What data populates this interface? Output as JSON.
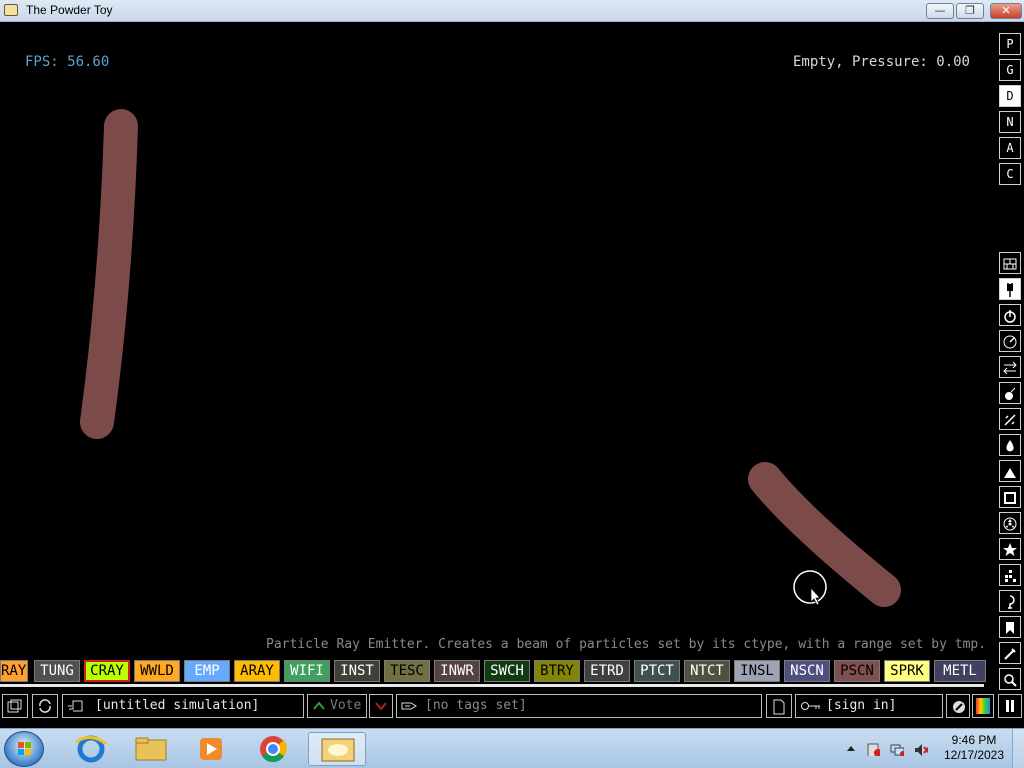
{
  "window": {
    "title": "The Powder Toy",
    "minimize": "—",
    "maximize": "❐",
    "close": "✕"
  },
  "hud": {
    "fps": "FPS: 56.60",
    "status": "Empty, Pressure: 0.00"
  },
  "element_description": "Particle Ray Emitter. Creates a beam of particles set by its ctype, with a range set by tmp.",
  "side_buttons_top": [
    "P",
    "G",
    "D",
    "N",
    "A",
    "C"
  ],
  "side_buttons_active": "D",
  "side_menu_icons": [
    "walls-icon",
    "electronics-icon",
    "powered-icon",
    "sensors-icon",
    "force-icon",
    "explosives-icon",
    "gases-icon",
    "liquids-icon",
    "powders-icon",
    "solids-icon",
    "radioactive-icon",
    "special-icon",
    "life-icon",
    "tools-icon",
    "favorites-icon",
    "decoration-icon",
    "search-icon"
  ],
  "elements": [
    {
      "label": "RAY",
      "bg": "#ffa030",
      "fg": "#000000"
    },
    {
      "label": "TUNG",
      "bg": "#505050",
      "fg": "#ffffff"
    },
    {
      "label": "CRAY",
      "bg": "#bbff00",
      "fg": "#000000",
      "selected": true
    },
    {
      "label": "WWLD",
      "bg": "#ffa820",
      "fg": "#000000"
    },
    {
      "label": "EMP",
      "bg": "#66aaff",
      "fg": "#ffffff"
    },
    {
      "label": "ARAY",
      "bg": "#ffbb00",
      "fg": "#000000"
    },
    {
      "label": "WIFI",
      "bg": "#40a060",
      "fg": "#ffffff"
    },
    {
      "label": "INST",
      "bg": "#404039",
      "fg": "#ffffff"
    },
    {
      "label": "TESC",
      "bg": "#707040",
      "fg": "#000000"
    },
    {
      "label": "INWR",
      "bg": "#544141",
      "fg": "#ffffff"
    },
    {
      "label": "SWCH",
      "bg": "#103b11",
      "fg": "#ffffff"
    },
    {
      "label": "BTRY",
      "bg": "#858505",
      "fg": "#000000"
    },
    {
      "label": "ETRD",
      "bg": "#404040",
      "fg": "#ffffff"
    },
    {
      "label": "PTCT",
      "bg": "#405050",
      "fg": "#ffffff"
    },
    {
      "label": "NTCT",
      "bg": "#505040",
      "fg": "#ffffff"
    },
    {
      "label": "INSL",
      "bg": "#9ea3b6",
      "fg": "#000000"
    },
    {
      "label": "NSCN",
      "bg": "#505080",
      "fg": "#ffffff"
    },
    {
      "label": "PSCN",
      "bg": "#805050",
      "fg": "#000000"
    },
    {
      "label": "SPRK",
      "bg": "#ffff80",
      "fg": "#000000"
    },
    {
      "label": "METL",
      "bg": "#404060",
      "fg": "#ffffff"
    }
  ],
  "bottom_bar": {
    "save_name": "[untitled simulation]",
    "vote": "Vote",
    "tags": "[no tags set]",
    "sign_in": "[sign in]"
  },
  "taskbar": {
    "time": "9:46 PM",
    "date": "12/17/2023"
  },
  "colors": {
    "sim_particle": "#7d4a4a",
    "fps_text": "#5fa0cc",
    "desc_text": "#8a8a8a",
    "vote_green": "#2ea02e",
    "vote_red": "#b02020"
  }
}
